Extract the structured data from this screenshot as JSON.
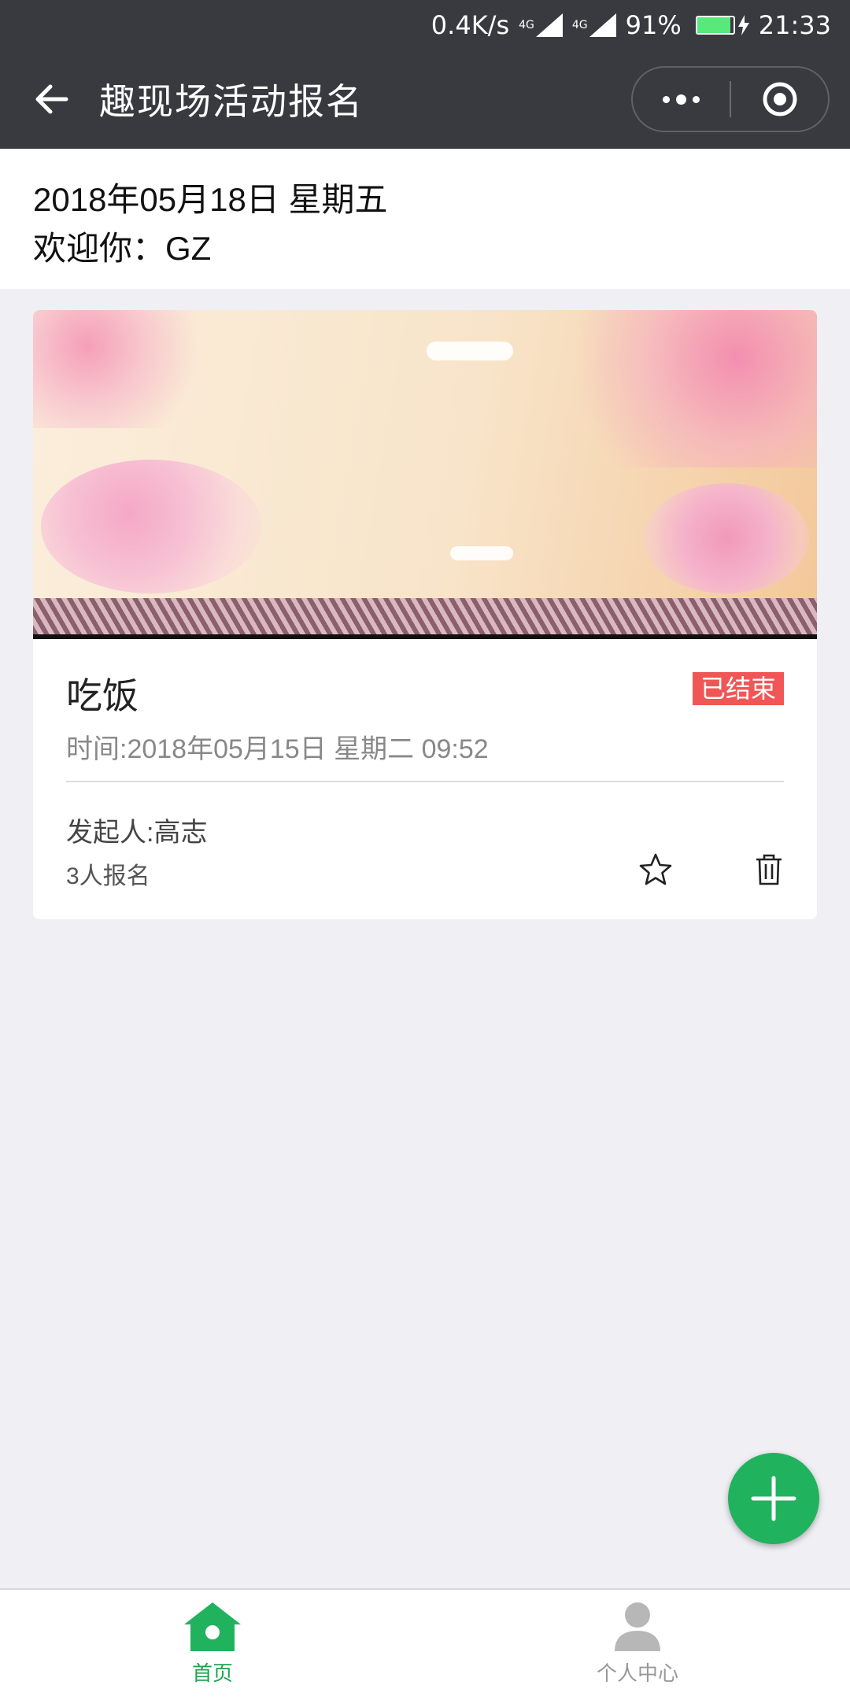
{
  "status_bar": {
    "network_speed": "0.4K/s",
    "sim1_type": "4G",
    "sim2_type": "4G",
    "battery_percent": "91%",
    "battery_level": 0.91,
    "time": "21:33"
  },
  "nav": {
    "title": "趣现场活动报名",
    "back_icon": "arrow-left-icon",
    "more_icon": "more-dots-icon",
    "close_icon": "target-circle-icon"
  },
  "header": {
    "date": "2018年05月18日 星期五",
    "welcome": "欢迎你：GZ"
  },
  "event": {
    "title": "吃饭",
    "status": "已结束",
    "time": "时间:2018年05月15日 星期二 09:52",
    "organizer": "发起人:高志",
    "signup_count": "3人报名"
  },
  "fab": {
    "icon": "plus-icon"
  },
  "tabbar": {
    "items": [
      {
        "label": "首页",
        "icon": "home-icon",
        "active": true
      },
      {
        "label": "个人中心",
        "icon": "user-icon",
        "active": false
      }
    ]
  },
  "colors": {
    "nav_bg": "#393a3f",
    "page_bg": "#efeff4",
    "accent_green": "#21b25e",
    "tab_active": "#1fa350",
    "tab_inactive": "#999999",
    "badge_red": "#f05656"
  }
}
